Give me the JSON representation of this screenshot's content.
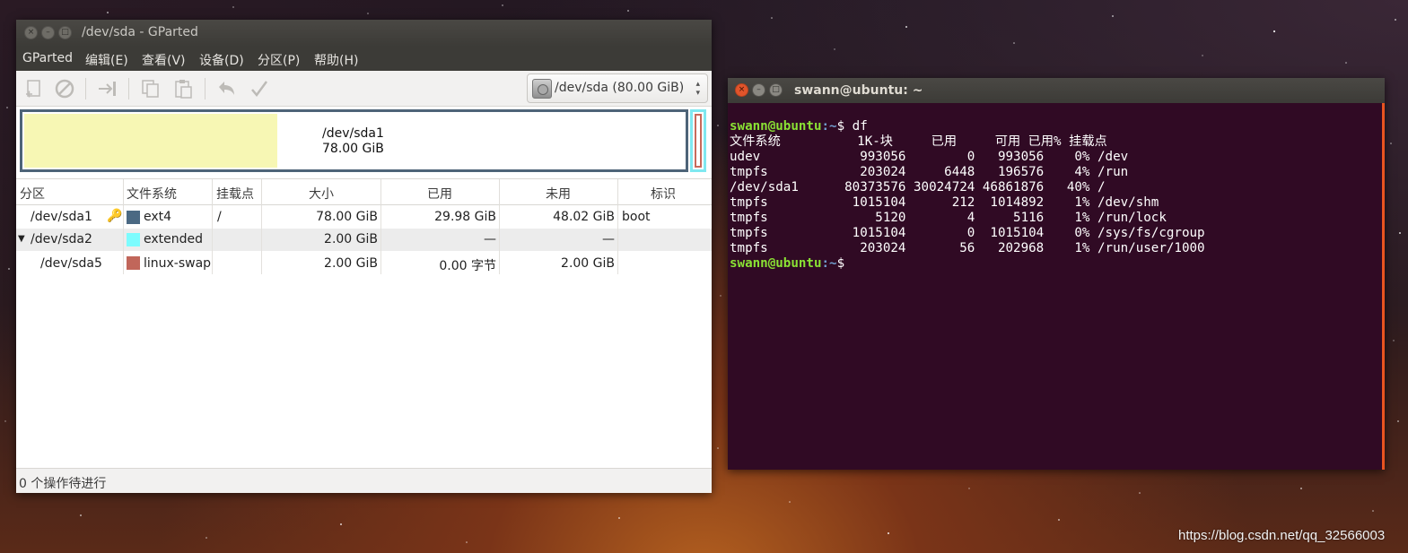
{
  "gparted": {
    "title": "/dev/sda - GParted",
    "window_buttons": [
      "×",
      "–",
      "□"
    ],
    "menu": [
      {
        "label": "GParted"
      },
      {
        "label": "编辑(E)"
      },
      {
        "label": "查看(V)"
      },
      {
        "label": "设备(D)"
      },
      {
        "label": "分区(P)"
      },
      {
        "label": "帮助(H)"
      }
    ],
    "toolbar_icons": [
      "new-partition-icon",
      "delete-icon",
      "resize-move-icon",
      "copy-icon",
      "paste-icon",
      "undo-icon",
      "apply-icon"
    ],
    "device_selector": {
      "label": "/dev/sda   (80.00 GiB)"
    },
    "disk_map": {
      "name": "/dev/sda1",
      "size": "78.00 GiB",
      "used_fraction": 0.384
    },
    "table": {
      "headers": [
        "分区",
        "文件系统",
        "挂载点",
        "大小",
        "已用",
        "未用",
        "标识"
      ],
      "rows": [
        {
          "partition": "/dev/sda1",
          "fs": "ext4",
          "mount": "/",
          "size": "78.00 GiB",
          "used": "29.98 GiB",
          "unused": "48.02 GiB",
          "flags": "boot",
          "color": "#4b6983"
        },
        {
          "partition": "/dev/sda2",
          "fs": "extended",
          "mount": "",
          "size": "2.00 GiB",
          "used": "—",
          "unused": "—",
          "flags": "",
          "color": "#7dfcfe"
        },
        {
          "partition": "/dev/sda5",
          "fs": "linux-swap",
          "mount": "",
          "size": "2.00 GiB",
          "used": "0.00 字节",
          "unused": "2.00 GiB",
          "flags": "",
          "color": "#c1665a"
        }
      ]
    },
    "status": "0 个操作待进行"
  },
  "terminal": {
    "title": "swann@ubuntu: ~",
    "window_buttons": [
      "×",
      "–",
      "□"
    ],
    "prompt_user": "swann@ubuntu",
    "prompt_path": ":~",
    "command": "$ df",
    "header": "文件系统          1K-块     已用     可用 已用% 挂载点",
    "rows": [
      "udev             993056        0   993056    0% /dev",
      "tmpfs            203024     6448   196576    4% /run",
      "/dev/sda1      80373576 30024724 46861876   40% /",
      "tmpfs           1015104      212  1014892    1% /dev/shm",
      "tmpfs              5120        4     5116    1% /run/lock",
      "tmpfs           1015104        0  1015104    0% /sys/fs/cgroup",
      "tmpfs            203024       56   202968    1% /run/user/1000"
    ],
    "final_prompt_tail": "$ "
  },
  "watermark": "https://blog.csdn.net/qq_32566003"
}
